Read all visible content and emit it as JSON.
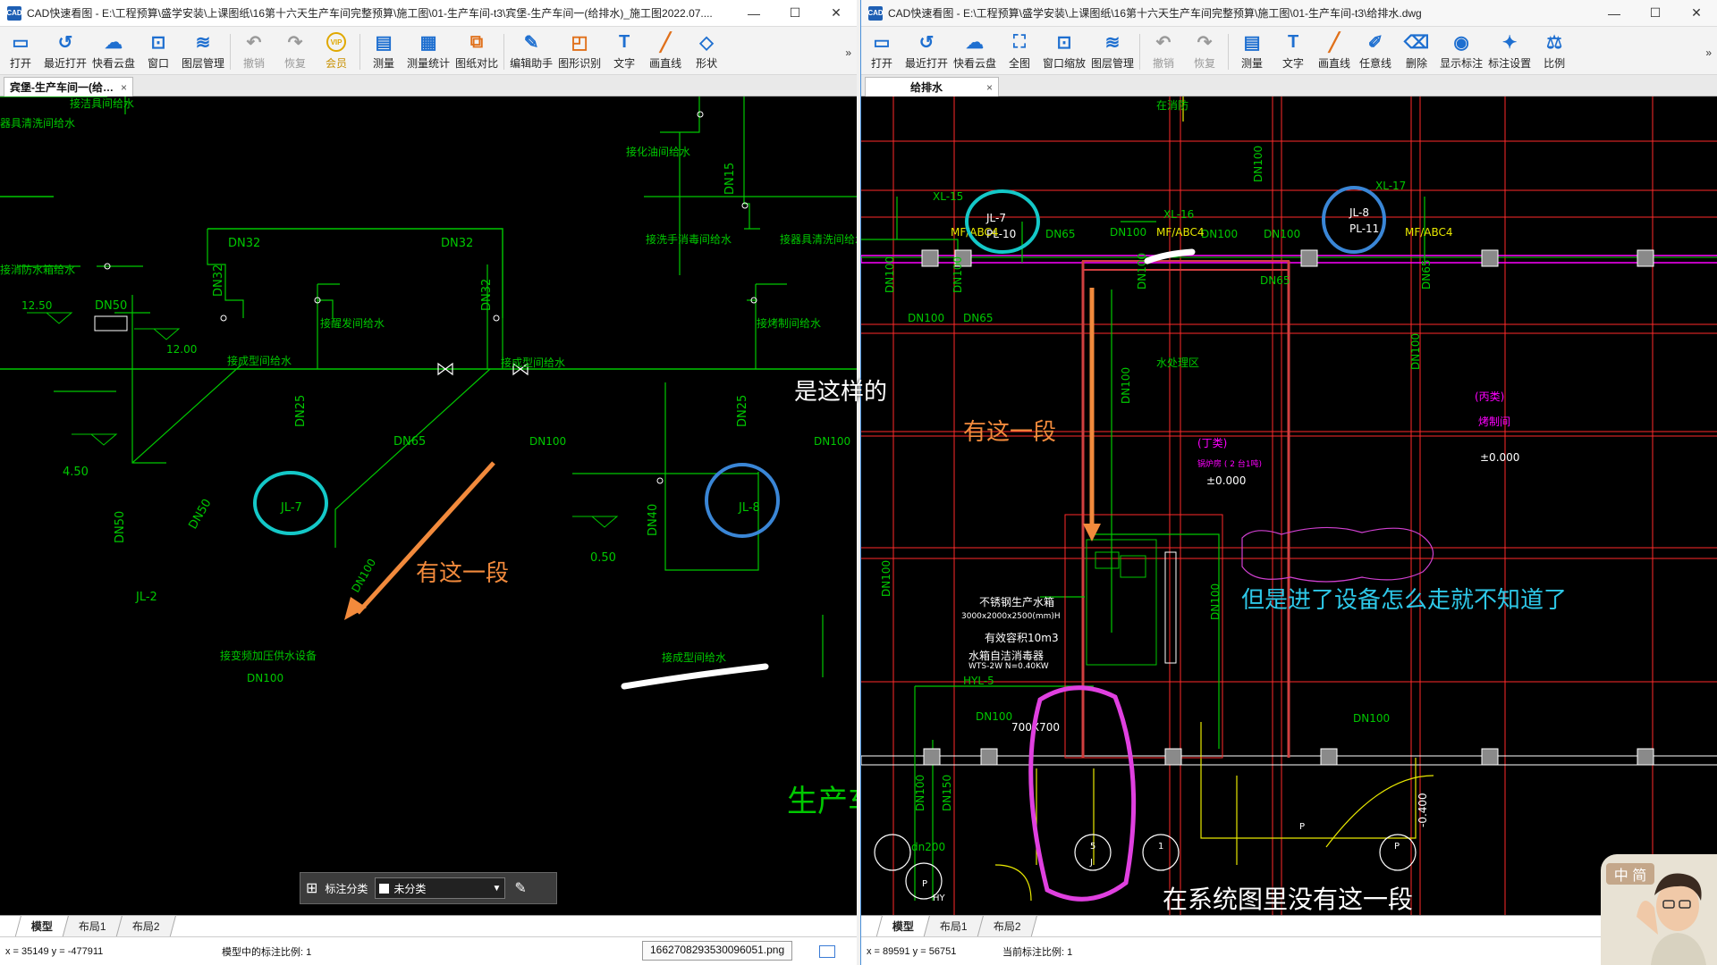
{
  "left_window": {
    "title": "CAD快速看图 - E:\\工程预算\\盛学安装\\上课图纸\\16第十六天生产车间完整预算\\施工图\\01-生产车间-t3\\宾堡-生产车间一(给排水)_施工图2022.07....",
    "toolbar": [
      {
        "label": "打开",
        "icon": "folder-open-icon",
        "color": "#1e6fd0"
      },
      {
        "label": "最近打开",
        "icon": "history-icon",
        "color": "#1e6fd0"
      },
      {
        "label": "快看云盘",
        "icon": "cloud-icon",
        "color": "#1e6fd0"
      },
      {
        "label": "窗口",
        "icon": "window-zoom-icon",
        "color": "#1e6fd0"
      },
      {
        "label": "图层管理",
        "icon": "layers-icon",
        "color": "#1e6fd0"
      },
      {
        "label": "撤销",
        "icon": "undo-icon",
        "color": "#999999"
      },
      {
        "label": "恢复",
        "icon": "redo-icon",
        "color": "#999999"
      },
      {
        "label": "会员",
        "icon": "vip-icon",
        "color": "#e0a800"
      },
      {
        "label": "测量",
        "icon": "ruler-icon",
        "color": "#1e6fd0"
      },
      {
        "label": "测量统计",
        "icon": "measure-stats-icon",
        "color": "#1e6fd0"
      },
      {
        "label": "图纸对比",
        "icon": "compare-icon",
        "color": "#e0701a"
      },
      {
        "label": "编辑助手",
        "icon": "edit-assistant-icon",
        "color": "#1e6fd0"
      },
      {
        "label": "图形识别",
        "icon": "shape-recognize-icon",
        "color": "#e0701a"
      },
      {
        "label": "文字",
        "icon": "text-icon",
        "color": "#1e6fd0"
      },
      {
        "label": "画直线",
        "icon": "line-icon",
        "color": "#e0701a"
      },
      {
        "label": "形状",
        "icon": "shapes-icon",
        "color": "#1e6fd0"
      }
    ],
    "more": "»",
    "tab": "宾堡-生产车间一(给…",
    "layout_tabs": [
      "模型",
      "布局1",
      "布局2"
    ],
    "status": {
      "coords": "x = 35149  y = -477911",
      "scale": "模型中的标注比例: 1",
      "file": "1662708293530096051.png"
    },
    "annotation_panel": {
      "label": "标注分类",
      "value": "未分类"
    },
    "drawing": {
      "labels": [
        "接洁具间给水",
        "器具清洗间给水",
        "接化油间给水",
        "DN15",
        "DN32",
        "DN32",
        "DN32",
        "DN32",
        "接洗手消毒间给水",
        "接器具清洗间给水",
        "接消防水箱给水",
        "DN50",
        "12.50",
        "12.00",
        "接醒发间给水",
        "接成型间给水",
        "接成型间给水",
        "接烤制间给水",
        "DN25",
        "DN25",
        "DN65",
        "DN100",
        "DN100",
        "4.50",
        "DN50",
        "DN50",
        "DN100",
        "JL-7",
        "JL-8",
        "JL-2",
        "DN40",
        "0.50",
        "接变频加压供水设备",
        "DN100",
        "接成型间给水",
        "生产车"
      ],
      "valve_marks": [
        "valve-1",
        "valve-2"
      ],
      "annotations": {
        "circle_jl7": "JL-7",
        "circle_jl8": "JL-8",
        "arrow_text": "有这一段"
      }
    }
  },
  "right_window": {
    "title": "CAD快速看图 - E:\\工程预算\\盛学安装\\上课图纸\\16第十六天生产车间完整预算\\施工图\\01-生产车间-t3\\给排水.dwg",
    "toolbar": [
      {
        "label": "打开",
        "icon": "folder-open-icon",
        "color": "#1e6fd0"
      },
      {
        "label": "最近打开",
        "icon": "history-icon",
        "color": "#1e6fd0"
      },
      {
        "label": "快看云盘",
        "icon": "cloud-icon",
        "color": "#1e6fd0"
      },
      {
        "label": "全图",
        "icon": "fit-all-icon",
        "color": "#1e6fd0"
      },
      {
        "label": "窗口缩放",
        "icon": "window-zoom-icon",
        "color": "#1e6fd0"
      },
      {
        "label": "图层管理",
        "icon": "layers-icon",
        "color": "#1e6fd0"
      },
      {
        "label": "撤销",
        "icon": "undo-icon",
        "color": "#999999"
      },
      {
        "label": "恢复",
        "icon": "redo-icon",
        "color": "#999999"
      },
      {
        "label": "测量",
        "icon": "ruler-icon",
        "color": "#1e6fd0"
      },
      {
        "label": "文字",
        "icon": "text-icon",
        "color": "#1e6fd0"
      },
      {
        "label": "画直线",
        "icon": "line-icon",
        "color": "#e0701a"
      },
      {
        "label": "任意线",
        "icon": "freehand-icon",
        "color": "#1e6fd0"
      },
      {
        "label": "删除",
        "icon": "eraser-icon",
        "color": "#1e6fd0"
      },
      {
        "label": "显示标注",
        "icon": "eye-icon",
        "color": "#1e6fd0"
      },
      {
        "label": "标注设置",
        "icon": "annotation-settings-icon",
        "color": "#1e6fd0"
      },
      {
        "label": "比例",
        "icon": "scale-icon",
        "color": "#1e6fd0"
      }
    ],
    "more": "»",
    "tab": "给排水",
    "layout_tabs": [
      "模型",
      "布局1",
      "布局2"
    ],
    "status": {
      "coords": "x = 89591  y = 56751",
      "scale": "当前标注比例: 1"
    },
    "drawing": {
      "labels": [
        "在消防",
        "DN100",
        "XL-15",
        "JL-7",
        "PL-10",
        "DN65",
        "DN100",
        "MF/ABC4",
        "XL-16",
        "DN100",
        "MF/ABC4",
        "DN100",
        "XL-17",
        "JL-8",
        "PL-11",
        "MF/ABC4",
        "DN65",
        "DN100",
        "DN100",
        "DN100",
        "DN65",
        "DN100",
        "DN65",
        "水处理区",
        "DN100",
        "DN100",
        "(丙类)",
        "烤制间",
        "±0.000",
        "(丁类)",
        "锅炉房 ( 2 台1吨)",
        "±0.000",
        "DN100",
        "DN100",
        "不锈钢生产水箱",
        "3000x2000x2500(mm)H",
        "有效容积10m3",
        "水箱自洁消毒器",
        "WTS-2W N=0.40KW",
        "HYL-5",
        "DN100",
        "700X700",
        "DN100",
        "DN150",
        "dn200",
        "P",
        "HY",
        "5",
        "J",
        "1",
        "P",
        "P",
        "-0.400",
        "DN100"
      ],
      "annotations": {
        "arrow_text": "有这一段",
        "note": "但是进了设备怎么走就不知道了",
        "circle_jl7": "JL-7",
        "circle_jl8": "JL-8"
      }
    }
  },
  "overlay": {
    "center_text": "是这样的",
    "bottom_caption": "在系统图里没有这一段",
    "webcam_badge": "中 简"
  },
  "colors": {
    "cad_green": "#00c800",
    "cad_red": "#ff2a2a",
    "cad_magenta": "#ff00ff",
    "cad_cyan": "#00e5ff",
    "cad_yellow": "#e8e800",
    "annot_orange": "#f28a3c",
    "annot_cyan": "#14c8c8",
    "annot_blue": "#3a86d6",
    "annot_pink": "#e040e0",
    "note_cyan": "#2ec8e8"
  }
}
